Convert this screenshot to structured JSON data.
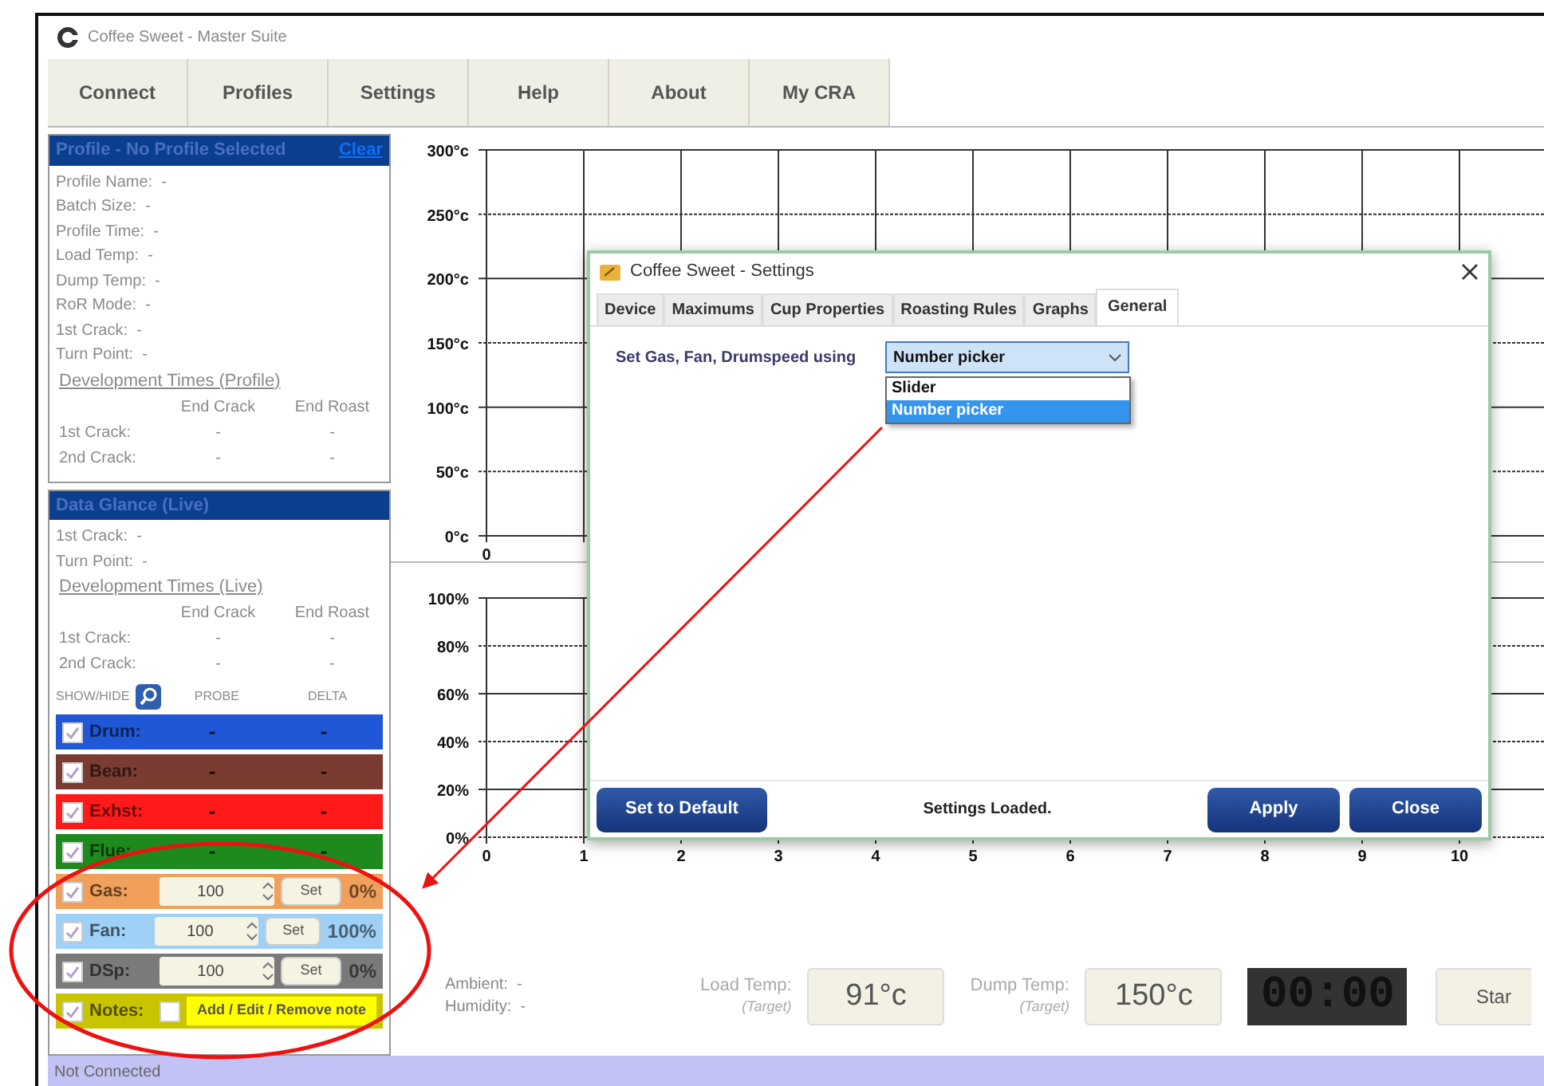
{
  "window": {
    "title": "Coffee Sweet - Master Suite"
  },
  "menu": [
    "Connect",
    "Profiles",
    "Settings",
    "Help",
    "About",
    "My CRA"
  ],
  "profile_panel": {
    "title": "Profile - No Profile Selected",
    "clear_link": "Clear",
    "lines": [
      "Profile Name:  -",
      "Batch Size:  -",
      "Profile Time:  -",
      "Load Temp:  -",
      "Dump Temp:  -",
      "RoR Mode:  -",
      "1st Crack:  -",
      "Turn Point:  -"
    ],
    "development": {
      "title": "Development Times (Profile)",
      "columns": [
        "End Crack",
        "End Roast"
      ],
      "rows": [
        {
          "label": "1st Crack:",
          "values": [
            "-",
            "-"
          ]
        },
        {
          "label": "2nd Crack:",
          "values": [
            "-",
            "-"
          ]
        }
      ]
    }
  },
  "data_glance": {
    "title": "Data Glance (Live)",
    "lines": [
      "1st Crack:  -",
      "Turn Point:  -"
    ],
    "development": {
      "title": "Development Times (Live)",
      "columns": [
        "End Crack",
        "End Roast"
      ],
      "rows": [
        {
          "label": "1st Crack:",
          "values": [
            "-",
            "-"
          ]
        },
        {
          "label": "2nd Crack:",
          "values": [
            "-",
            "-"
          ]
        }
      ]
    },
    "show_hide_label": "SHOW/HIDE",
    "columns": [
      "PROBE",
      "DELTA"
    ]
  },
  "channels": [
    {
      "kind": "probe",
      "name": "Drum:",
      "checked": true,
      "probe": "-",
      "delta": "-",
      "color": "#1f57d6"
    },
    {
      "kind": "probe",
      "name": "Bean:",
      "checked": true,
      "probe": "-",
      "delta": "-",
      "color": "#7a3b30"
    },
    {
      "kind": "probe",
      "name": "Exhst:",
      "checked": true,
      "probe": "-",
      "delta": "-",
      "color": "#ff1a1a"
    },
    {
      "kind": "probe",
      "name": "Flue:",
      "checked": true,
      "probe": "-",
      "delta": "-",
      "color": "#1e8a1e"
    },
    {
      "kind": "control",
      "name": "Gas:",
      "checked": true,
      "value": "100",
      "set_button": "Set",
      "reading": "0%",
      "color": "#f0a05a"
    },
    {
      "kind": "control",
      "name": "Fan:",
      "checked": true,
      "value": "100",
      "set_button": "Set",
      "reading": "100%",
      "color": "#9fd0f5"
    },
    {
      "kind": "control",
      "name": "DSp:",
      "checked": true,
      "value": "100",
      "set_button": "Set",
      "reading": "0%",
      "color": "#7a7a7a"
    },
    {
      "kind": "notes",
      "name": "Notes:",
      "checked": true,
      "note_checked": false,
      "button": "Add / Edit / Remove note",
      "color": "#c9c400"
    }
  ],
  "temperature_chart": {
    "y_labels": [
      "300°c",
      "250°c",
      "200°c",
      "150°c",
      "100°c",
      "50°c",
      "0°c"
    ],
    "x_labels": [
      "0"
    ]
  },
  "output_chart": {
    "y_labels": [
      "100%",
      "80%",
      "60%",
      "40%",
      "20%",
      "0%"
    ],
    "x_labels": [
      "0",
      "1",
      "2",
      "3",
      "4",
      "5",
      "6",
      "7",
      "8",
      "9",
      "10"
    ]
  },
  "readouts": [
    "Ambient:  -",
    "Humidity:  -"
  ],
  "targets": [
    {
      "label": "Load Temp:",
      "sublabel": "(Target)",
      "value": "91°c"
    },
    {
      "label": "Dump Temp:",
      "sublabel": "(Target)",
      "value": "150°c"
    }
  ],
  "timer": "00:00",
  "start_button": "Star",
  "status_bar": "Not Connected",
  "settings_dialog": {
    "title": "Coffee Sweet - Settings",
    "tabs": [
      {
        "label": "Device",
        "selected": false
      },
      {
        "label": "Maximums",
        "selected": false
      },
      {
        "label": "Cup Properties",
        "selected": false
      },
      {
        "label": "Roasting Rules",
        "selected": false
      },
      {
        "label": "Graphs",
        "selected": false
      },
      {
        "label": "General",
        "selected": true
      }
    ],
    "setting": {
      "label": "Set Gas, Fan, Drumspeed using",
      "value": "Number picker",
      "options": [
        {
          "label": "Slider",
          "selected": false
        },
        {
          "label": "Number picker",
          "selected": true
        }
      ]
    },
    "default_button": "Set to Default",
    "status": "Settings Loaded.",
    "buttons": [
      "Apply",
      "Close"
    ]
  }
}
